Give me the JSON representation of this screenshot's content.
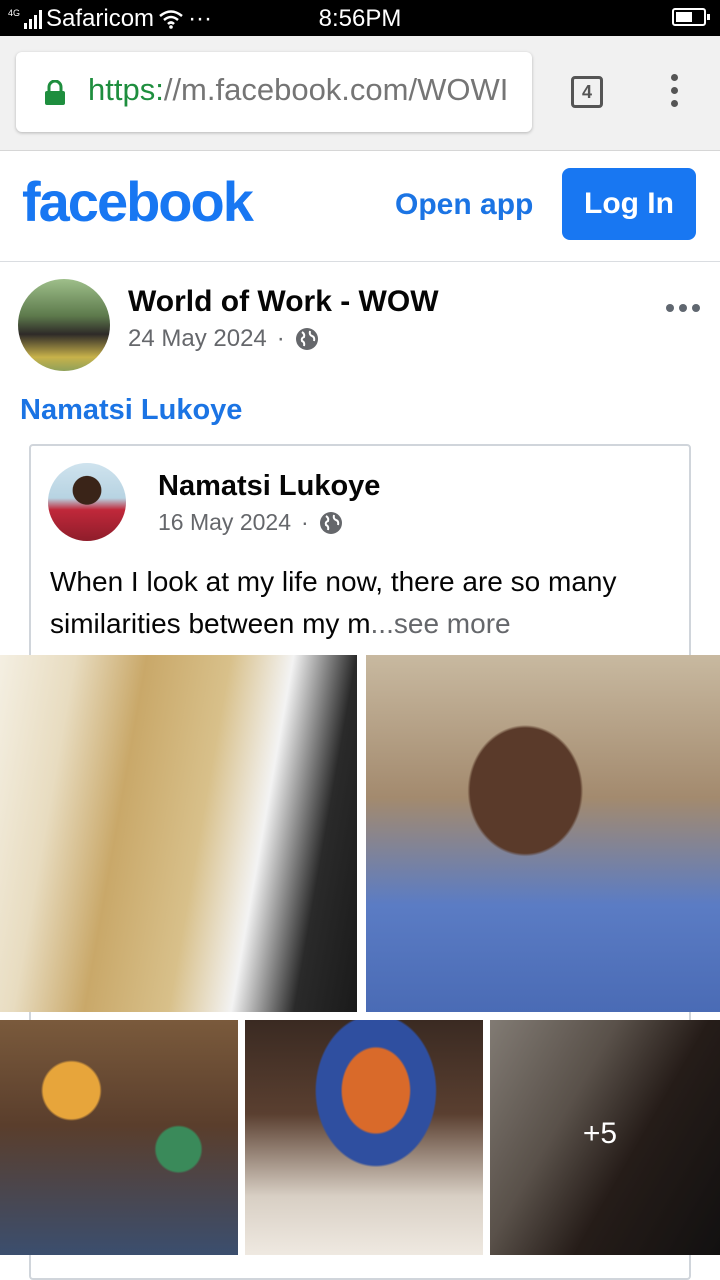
{
  "status_bar": {
    "network": "4G",
    "carrier": "Safaricom",
    "extra": "···",
    "time": "8:56PM"
  },
  "browser": {
    "url_scheme": "https:",
    "url_rest": "//m.facebook.com/WOWI",
    "tab_count": "4",
    "accent_color": "#1e8e3e"
  },
  "header": {
    "logo": "facebook",
    "open_app": "Open app",
    "login": "Log In",
    "brand_color": "#1877f2"
  },
  "post": {
    "page_name": "World of Work - WOW",
    "date": "24 May 2024",
    "separator": "·",
    "shared_from": "Namatsi Lukoye",
    "shared": {
      "author": "Namatsi Lukoye",
      "date": "16 May 2024",
      "separator": "·",
      "text": "When I look at my life now, there are so many similarities between my m",
      "see_more": "...see more",
      "more_photos": "+5"
    }
  }
}
